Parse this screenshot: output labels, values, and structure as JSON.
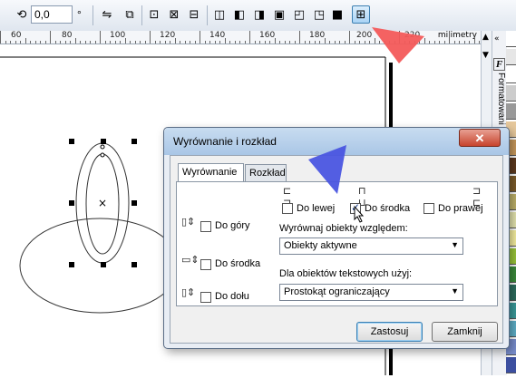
{
  "toolbar": {
    "rotation_value": "0,0",
    "degree_symbol": "°",
    "icons": [
      "rotate-icon",
      "mirror-icon",
      "group-icon",
      "ungroup-icon",
      "ungroup-all-icon",
      "combine-icon",
      "weld-icon",
      "trim-icon",
      "intersect-icon",
      "simplify-icon",
      "front-minus-back-icon",
      "back-minus-front-icon",
      "create-boundary-icon",
      "align-distribute-icon"
    ]
  },
  "ruler": {
    "labels": [
      "60",
      "80",
      "100",
      "120",
      "140",
      "160",
      "180",
      "200",
      "220"
    ],
    "units": "milimetry"
  },
  "docker": {
    "label": "Formatowani"
  },
  "palette": {
    "colors": [
      "#ffffff",
      "#e6e6e6",
      "#ffffff",
      "#cccccc",
      "#999999",
      "#e6c89c",
      "#c99a5c",
      "#5f3a1f",
      "#7d5c2a",
      "#bfb26a",
      "#e6e6b0",
      "#f7f0a0",
      "#9bc73a",
      "#3c8c3c",
      "#2d6e5f",
      "#3c9c9c",
      "#5fb0c9",
      "#7a8fcf",
      "#3c4fa0"
    ]
  },
  "dialog": {
    "title": "Wyrównanie i rozkład",
    "close_symbol": "✕",
    "tabs": [
      "Wyrównanie",
      "Rozkład"
    ],
    "horizontal": {
      "left_label": "Do lewej",
      "center_label": "Do środka",
      "right_label": "Do prawej",
      "left_checked": false,
      "center_checked": true,
      "right_checked": false
    },
    "vertical": {
      "top_label": "Do góry",
      "middle_label": "Do środka",
      "bottom_label": "Do dołu",
      "top_checked": false,
      "middle_checked": false,
      "bottom_checked": false
    },
    "align_to_label": "Wyrównaj obiekty względem:",
    "align_to_value": "Obiekty aktywne",
    "text_objects_label": "Dla obiektów tekstowych użyj:",
    "text_objects_value": "Prostokąt ograniczający",
    "apply_label": "Zastosuj",
    "close_label": "Zamknij"
  },
  "colors": {
    "dialog_title_bg": "#b4cfe9",
    "close_button": "#c7432c",
    "annotation_arrow_red": "#f35a5a",
    "annotation_arrow_blue": "#4a55e0"
  }
}
